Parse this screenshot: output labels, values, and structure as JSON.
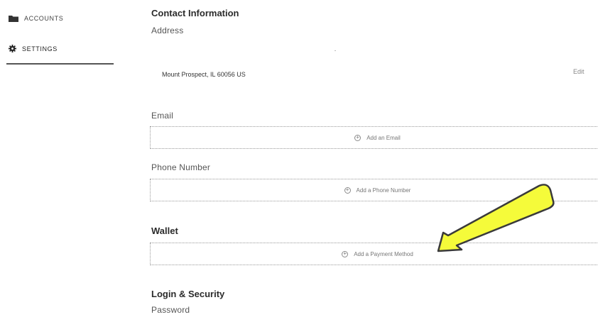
{
  "sidebar": {
    "items": [
      {
        "label": "ACCOUNTS",
        "icon": "folder-icon"
      },
      {
        "label": "SETTINGS",
        "icon": "gear-icon"
      }
    ]
  },
  "contact": {
    "title": "Contact Information",
    "address_label": "Address",
    "address_line": "Mount Prospect, IL 60056 US",
    "edit_label": "Edit"
  },
  "email": {
    "label": "Email",
    "add_label": "Add an Email"
  },
  "phone": {
    "label": "Phone Number",
    "add_label": "Add a Phone Number"
  },
  "wallet": {
    "title": "Wallet",
    "add_label": "Add a Payment Method"
  },
  "security": {
    "title": "Login & Security",
    "password_label": "Password"
  },
  "colors": {
    "annotation_arrow_fill": "#f5fb3a",
    "annotation_arrow_stroke": "#3a3a3a"
  }
}
